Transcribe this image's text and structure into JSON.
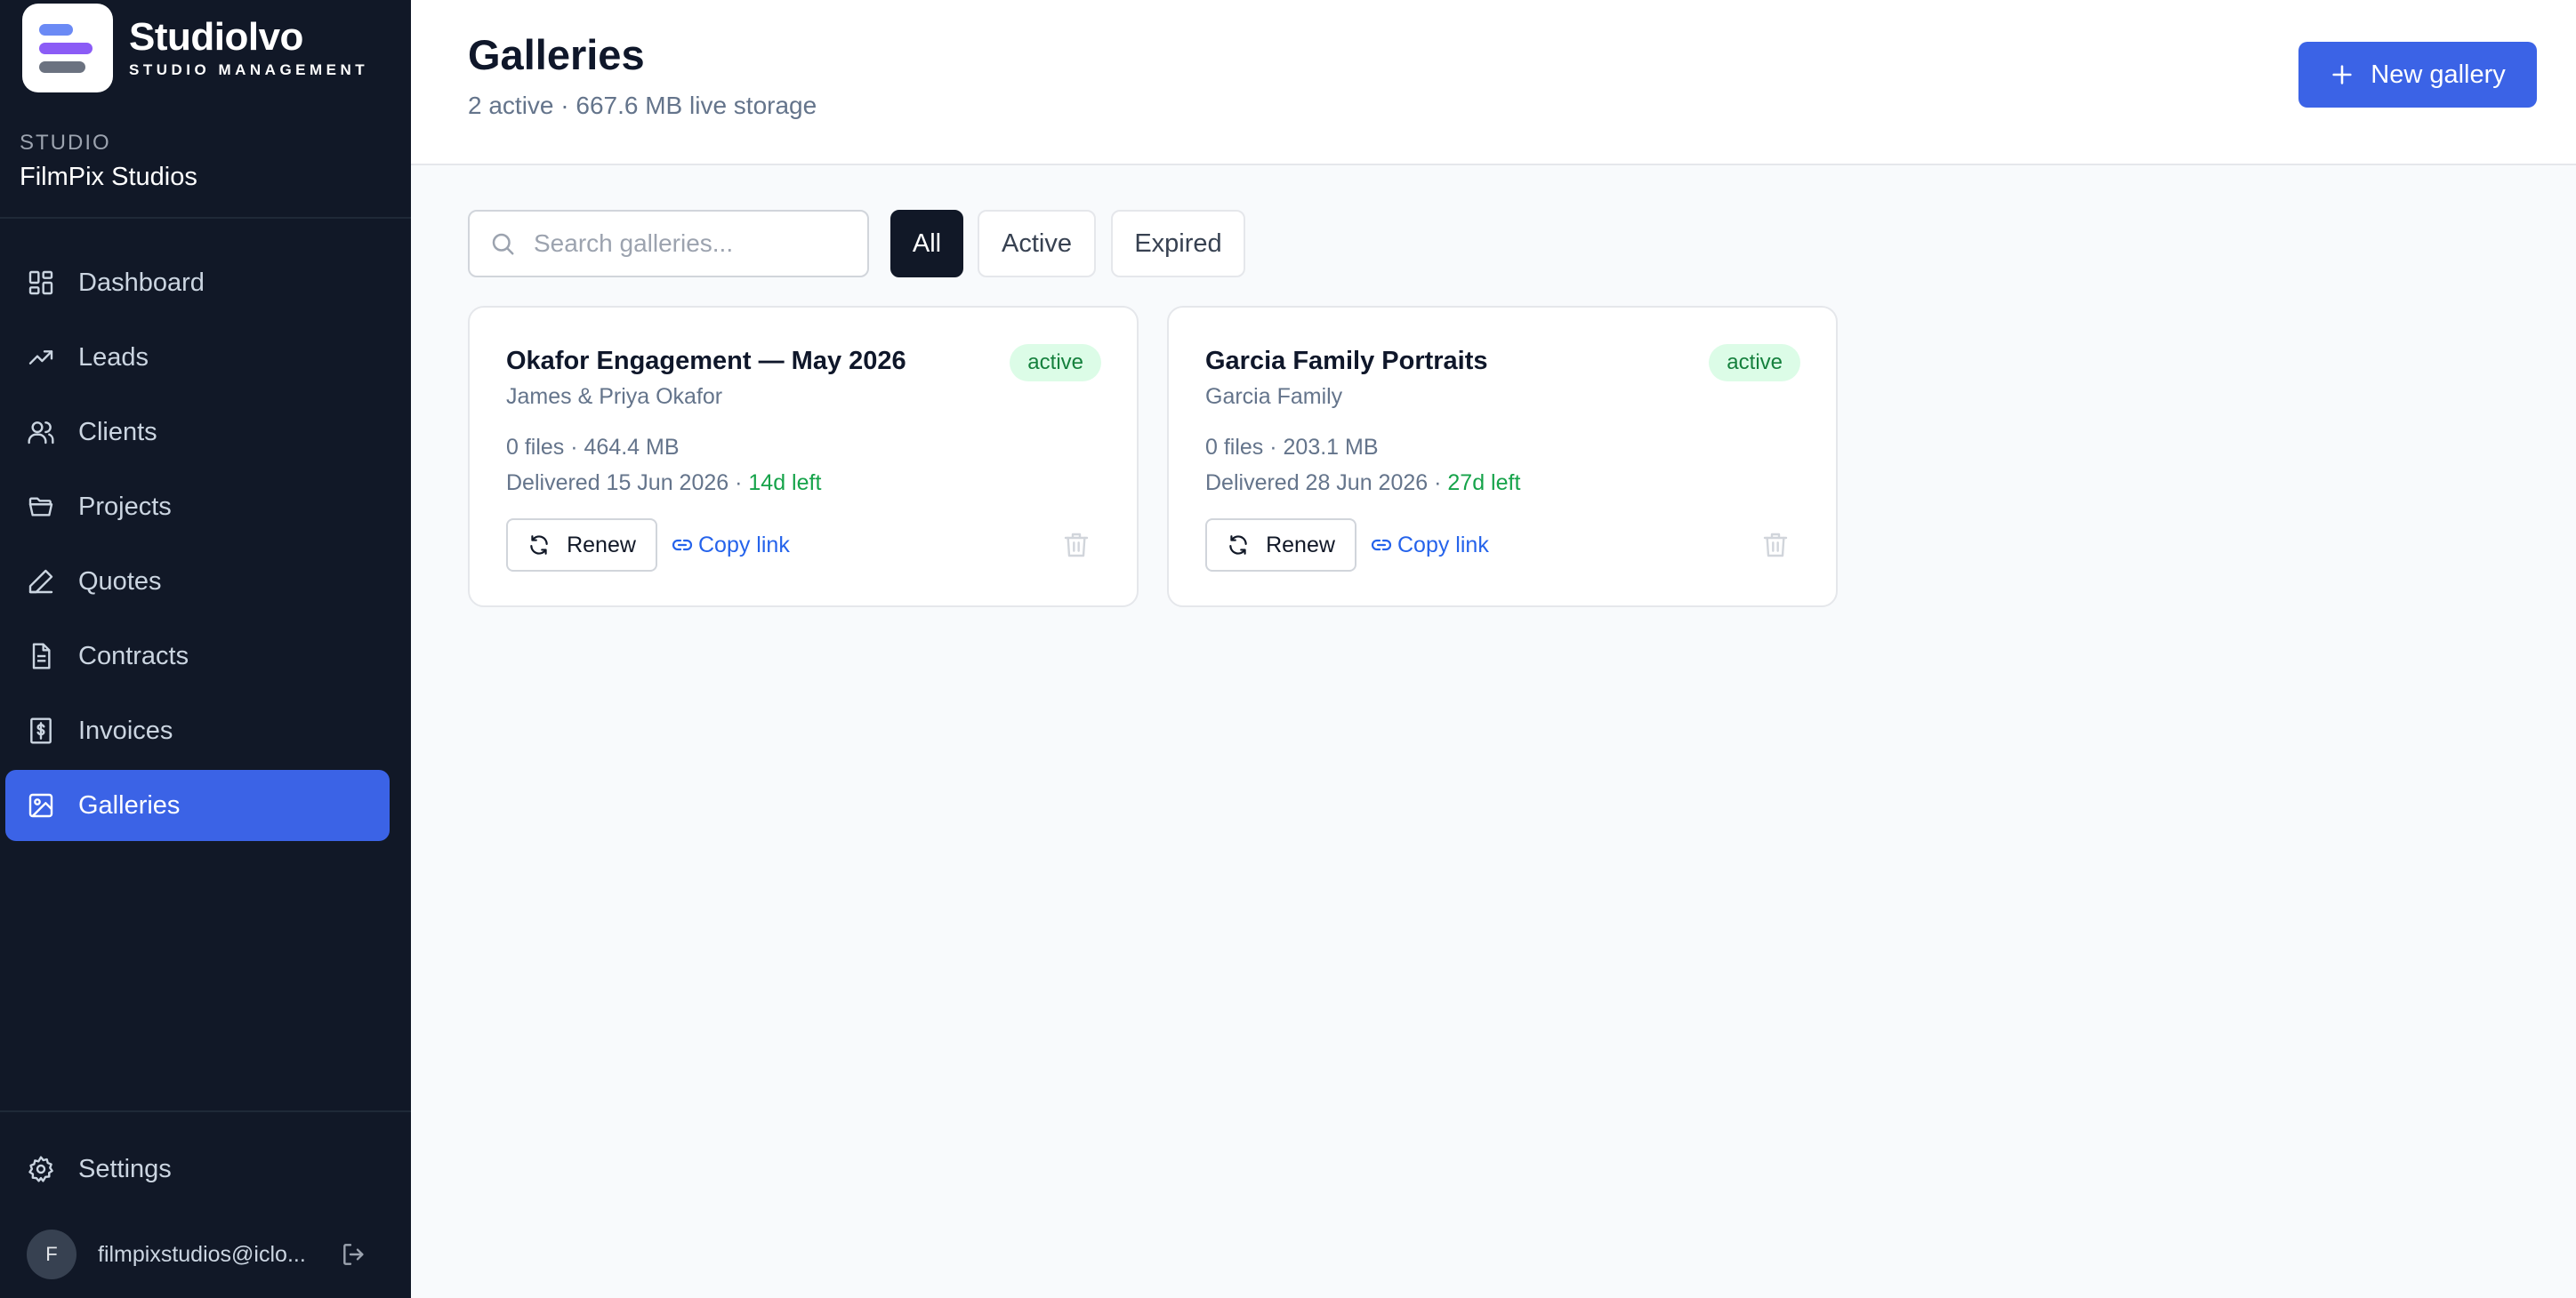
{
  "brand": {
    "name": "Studiolvo",
    "tagline": "STUDIO MANAGEMENT"
  },
  "studio": {
    "label": "STUDIO",
    "name": "FilmPix Studios"
  },
  "nav": {
    "items": [
      {
        "label": "Dashboard",
        "icon": "grid-icon"
      },
      {
        "label": "Leads",
        "icon": "trending-up-icon"
      },
      {
        "label": "Clients",
        "icon": "users-icon"
      },
      {
        "label": "Projects",
        "icon": "folder-icon"
      },
      {
        "label": "Quotes",
        "icon": "pen-icon"
      },
      {
        "label": "Contracts",
        "icon": "document-icon"
      },
      {
        "label": "Invoices",
        "icon": "invoice-icon"
      },
      {
        "label": "Galleries",
        "icon": "image-icon",
        "active": true
      }
    ],
    "settings": {
      "label": "Settings",
      "icon": "gear-icon"
    }
  },
  "user": {
    "initial": "F",
    "email": "filmpixstudios@iclo..."
  },
  "header": {
    "title": "Galleries",
    "subtitle": "2 active · 667.6 MB live storage",
    "new_button": "New gallery"
  },
  "search": {
    "placeholder": "Search galleries...",
    "value": ""
  },
  "filters": {
    "all": "All",
    "active": "Active",
    "expired": "Expired",
    "selected": "All"
  },
  "galleries": [
    {
      "title": "Okafor Engagement — May 2026",
      "client": "James & Priya Okafor",
      "status": "active",
      "meta": "0 files · 464.4 MB",
      "delivered": "Delivered 15 Jun 2026 · ",
      "days_left": "14d left",
      "renew": "Renew",
      "copy": "Copy link"
    },
    {
      "title": "Garcia Family Portraits",
      "client": "Garcia Family",
      "status": "active",
      "meta": "0 files · 203.1 MB",
      "delivered": "Delivered 28 Jun 2026 · ",
      "days_left": "27d left",
      "renew": "Renew",
      "copy": "Copy link"
    }
  ],
  "colors": {
    "sidebar": "#111827",
    "accent": "#3b63e6",
    "success": "#16a34a",
    "badge_bg": "#dcfce7"
  }
}
